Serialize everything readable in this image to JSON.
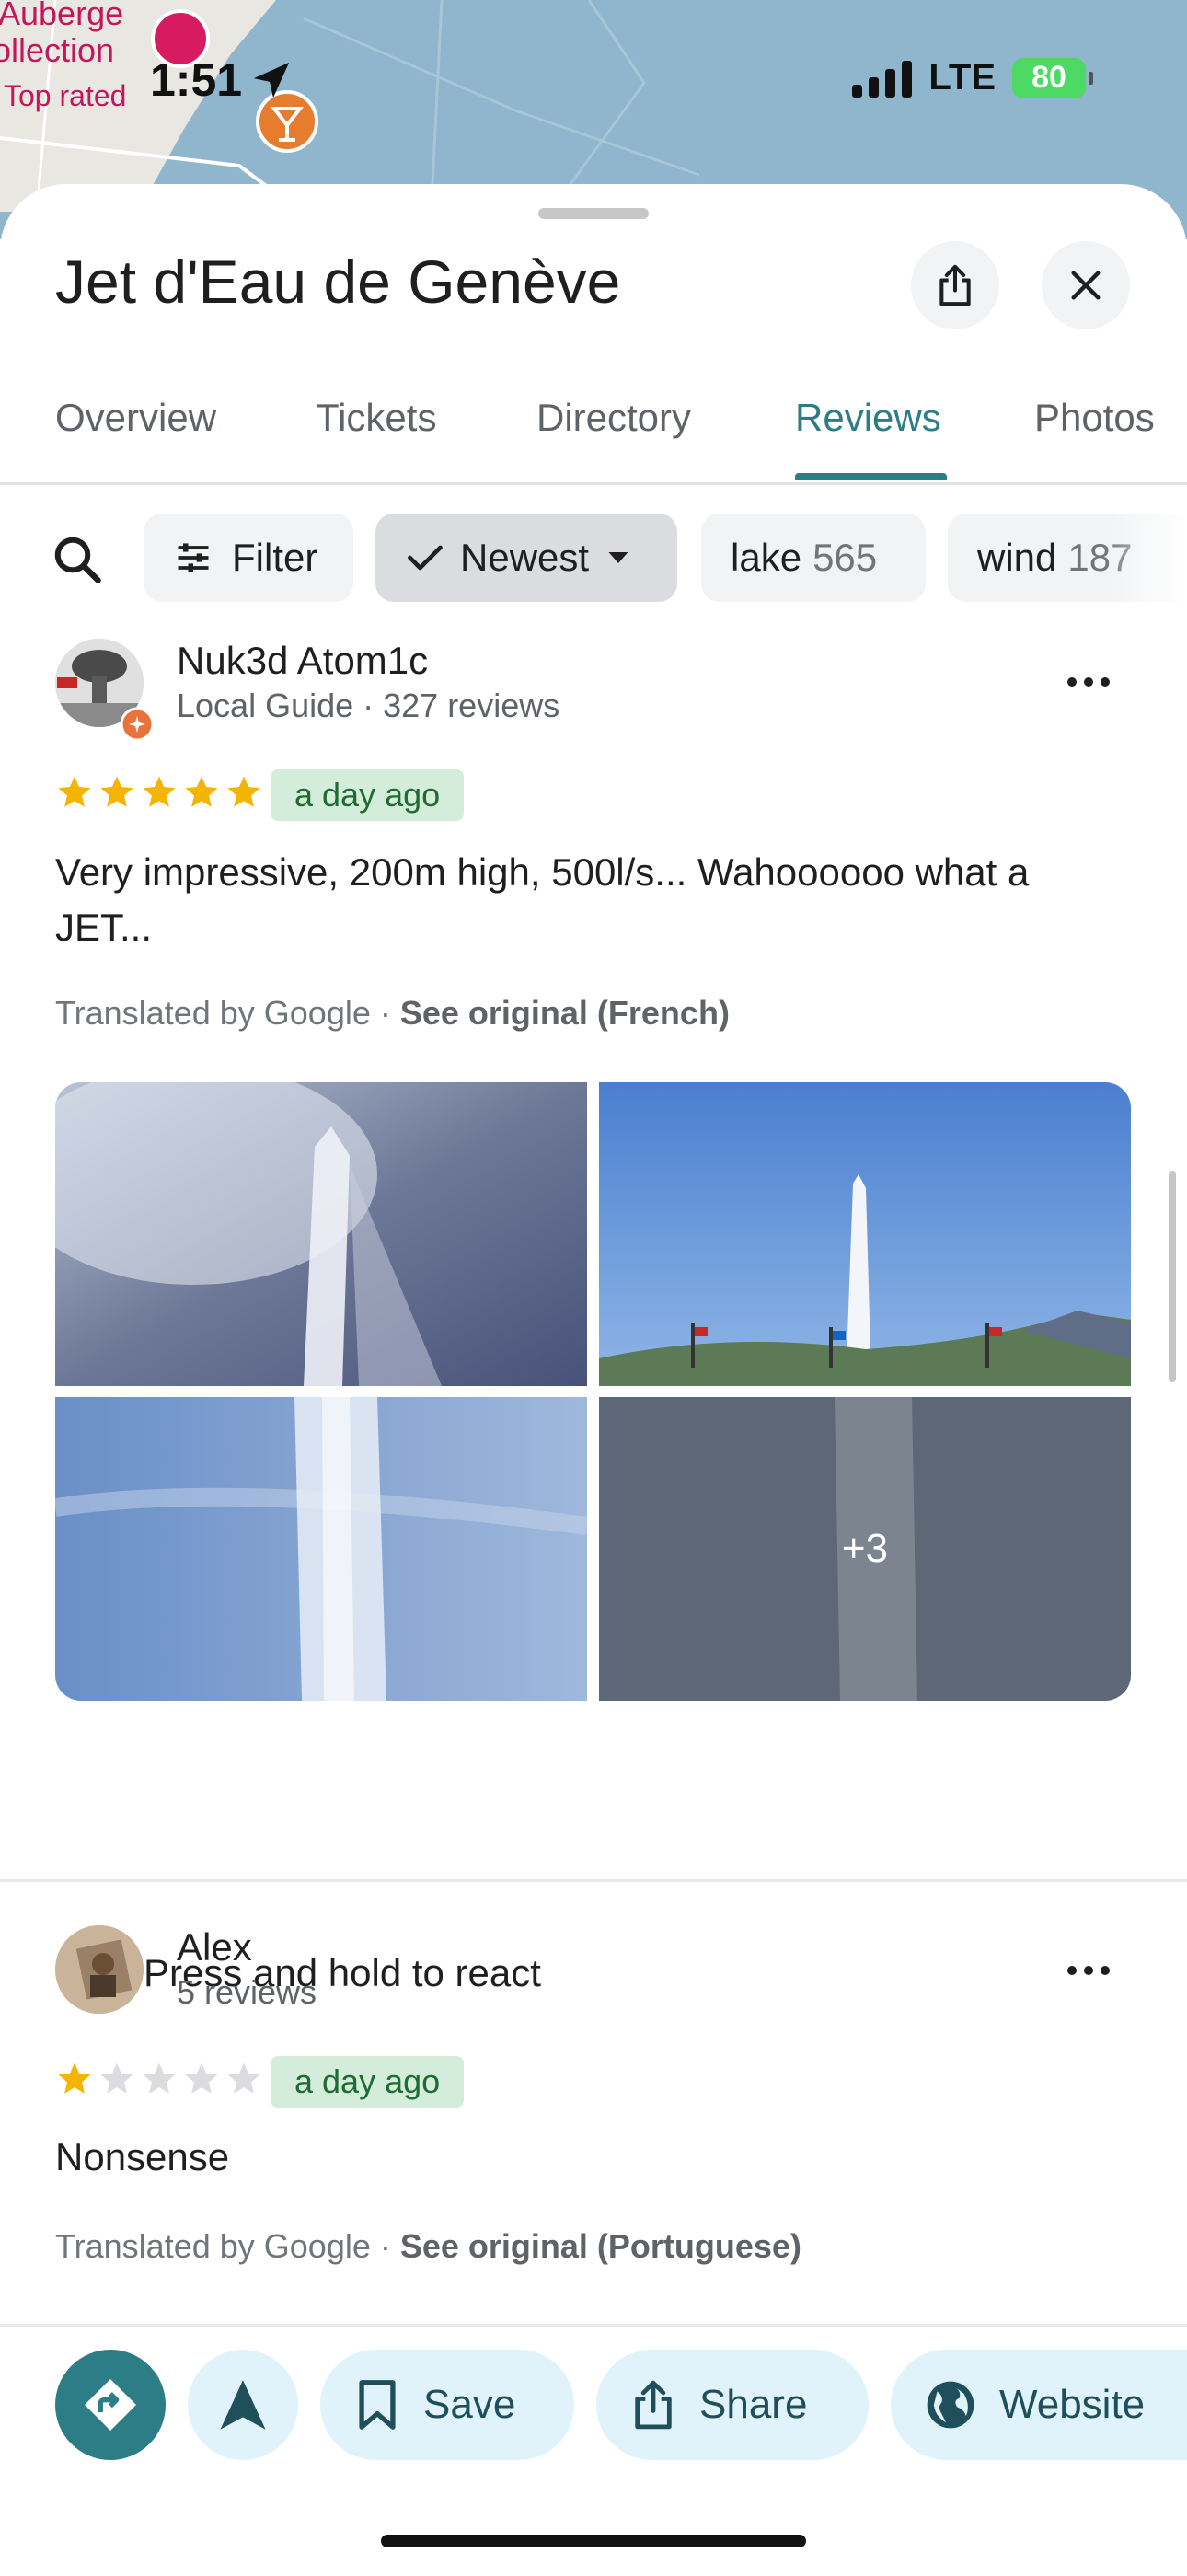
{
  "status_bar": {
    "time": "1:51",
    "network": "LTE",
    "battery": "80"
  },
  "map": {
    "labels": [
      "Auberge",
      "ollection",
      "Top rated"
    ]
  },
  "place": {
    "title": "Jet d'Eau de Genève"
  },
  "tabs": [
    {
      "label": "Overview",
      "active": false
    },
    {
      "label": "Tickets",
      "active": false
    },
    {
      "label": "Directory",
      "active": false
    },
    {
      "label": "Reviews",
      "active": true
    },
    {
      "label": "Photos",
      "active": false
    }
  ],
  "chips": {
    "filter": "Filter",
    "sort": "Newest",
    "topics": [
      {
        "label": "lake",
        "count": "565"
      },
      {
        "label": "wind",
        "count": "187"
      }
    ]
  },
  "reviews": [
    {
      "name": "Nuk3d Atom1c",
      "meta": "Local Guide · 327 reviews",
      "rating": 5,
      "date": "a day ago",
      "text": "Very impressive, 200m high, 500l/s... Wahoooooo what a JET...",
      "translated_prefix": "Translated by Google · ",
      "see_original": "See original (French)",
      "more_photos": "+3",
      "react": "Press and hold to react"
    },
    {
      "name": "Alex",
      "meta": "5 reviews",
      "rating": 1,
      "date": "a day ago",
      "text": "Nonsense",
      "translated_prefix": "Translated by Google · ",
      "see_original": "See original (Portuguese)"
    }
  ],
  "actions": {
    "save": "Save",
    "share": "Share",
    "website": "Website"
  },
  "colors": {
    "accent": "#2d7d87",
    "star": "#f4b400",
    "action_bg": "#e0f3fa"
  }
}
